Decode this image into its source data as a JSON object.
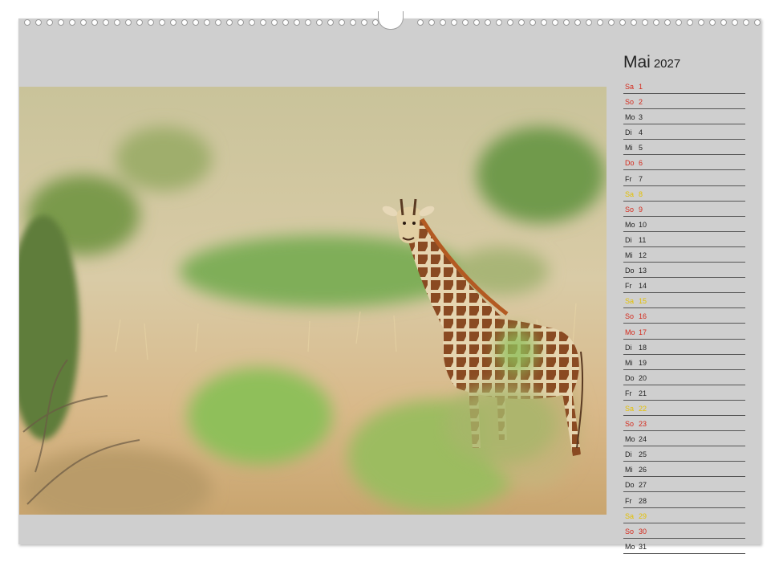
{
  "calendar": {
    "month": "Mai",
    "year": "2027",
    "days": [
      {
        "weekday": "Sa",
        "day": "1",
        "style": "red"
      },
      {
        "weekday": "So",
        "day": "2",
        "style": "red"
      },
      {
        "weekday": "Mo",
        "day": "3",
        "style": "normal"
      },
      {
        "weekday": "Di",
        "day": "4",
        "style": "normal"
      },
      {
        "weekday": "Mi",
        "day": "5",
        "style": "normal"
      },
      {
        "weekday": "Do",
        "day": "6",
        "style": "red"
      },
      {
        "weekday": "Fr",
        "day": "7",
        "style": "normal"
      },
      {
        "weekday": "Sa",
        "day": "8",
        "style": "yellow"
      },
      {
        "weekday": "So",
        "day": "9",
        "style": "red"
      },
      {
        "weekday": "Mo",
        "day": "10",
        "style": "normal"
      },
      {
        "weekday": "Di",
        "day": "11",
        "style": "normal"
      },
      {
        "weekday": "Mi",
        "day": "12",
        "style": "normal"
      },
      {
        "weekday": "Do",
        "day": "13",
        "style": "normal"
      },
      {
        "weekday": "Fr",
        "day": "14",
        "style": "normal"
      },
      {
        "weekday": "Sa",
        "day": "15",
        "style": "yellow"
      },
      {
        "weekday": "So",
        "day": "16",
        "style": "red"
      },
      {
        "weekday": "Mo",
        "day": "17",
        "style": "red"
      },
      {
        "weekday": "Di",
        "day": "18",
        "style": "normal"
      },
      {
        "weekday": "Mi",
        "day": "19",
        "style": "normal"
      },
      {
        "weekday": "Do",
        "day": "20",
        "style": "normal"
      },
      {
        "weekday": "Fr",
        "day": "21",
        "style": "normal"
      },
      {
        "weekday": "Sa",
        "day": "22",
        "style": "yellow"
      },
      {
        "weekday": "So",
        "day": "23",
        "style": "red"
      },
      {
        "weekday": "Mo",
        "day": "24",
        "style": "normal"
      },
      {
        "weekday": "Di",
        "day": "25",
        "style": "normal"
      },
      {
        "weekday": "Mi",
        "day": "26",
        "style": "normal"
      },
      {
        "weekday": "Do",
        "day": "27",
        "style": "normal"
      },
      {
        "weekday": "Fr",
        "day": "28",
        "style": "normal"
      },
      {
        "weekday": "Sa",
        "day": "29",
        "style": "yellow"
      },
      {
        "weekday": "So",
        "day": "30",
        "style": "red"
      },
      {
        "weekday": "Mo",
        "day": "31",
        "style": "normal"
      }
    ]
  },
  "colors": {
    "page_background": "#cfcfcf",
    "holiday_red": "#d42a1c",
    "saturday_yellow": "#e4c000",
    "text": "#222222"
  },
  "photo": {
    "subject": "giraffe-in-savanna"
  }
}
